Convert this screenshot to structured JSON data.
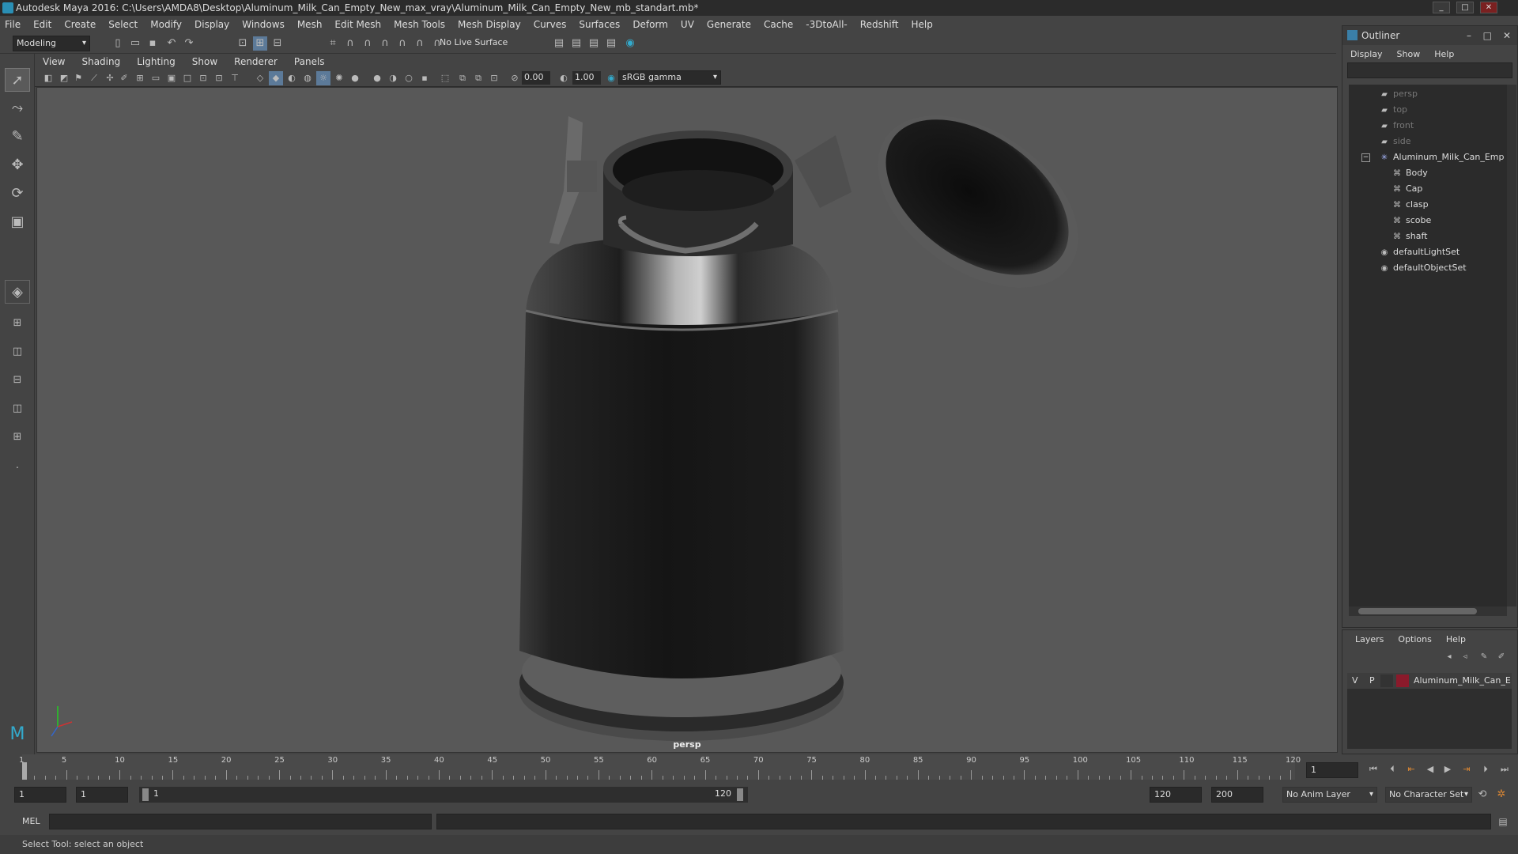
{
  "window": {
    "title": "Autodesk Maya 2016: C:\\Users\\AMDA8\\Desktop\\Aluminum_Milk_Can_Empty_New_max_vray\\Aluminum_Milk_Can_Empty_New_mb_standart.mb*"
  },
  "menubar": [
    "File",
    "Edit",
    "Create",
    "Select",
    "Modify",
    "Display",
    "Windows",
    "Mesh",
    "Edit Mesh",
    "Mesh Tools",
    "Mesh Display",
    "Curves",
    "Surfaces",
    "Deform",
    "UV",
    "Generate",
    "Cache",
    "-3DtoAll-",
    "Redshift",
    "Help"
  ],
  "statusline": {
    "mode": "Modeling",
    "live_surface": "No Live Surface"
  },
  "panel": {
    "menus": [
      "View",
      "Shading",
      "Lighting",
      "Show",
      "Renderer",
      "Panels"
    ],
    "exposure": "0.00",
    "gamma": "1.00",
    "color_space": "sRGB gamma",
    "camera_label": "persp"
  },
  "outliner": {
    "title": "Outliner",
    "menus": [
      "Display",
      "Show",
      "Help"
    ],
    "items": [
      {
        "label": "persp",
        "type": "camera"
      },
      {
        "label": "top",
        "type": "camera"
      },
      {
        "label": "front",
        "type": "camera"
      },
      {
        "label": "side",
        "type": "camera"
      },
      {
        "label": "Aluminum_Milk_Can_Emp",
        "type": "group"
      },
      {
        "label": "Body",
        "type": "mesh"
      },
      {
        "label": "Cap",
        "type": "mesh"
      },
      {
        "label": "clasp",
        "type": "mesh"
      },
      {
        "label": "scobe",
        "type": "mesh"
      },
      {
        "label": "shaft",
        "type": "mesh"
      },
      {
        "label": "defaultLightSet",
        "type": "set"
      },
      {
        "label": "defaultObjectSet",
        "type": "set"
      }
    ]
  },
  "layers": {
    "menus": [
      "Layers",
      "Options",
      "Help"
    ],
    "layer": {
      "v": "V",
      "p": "P",
      "name": "Aluminum_Milk_Can_E",
      "color": "#8b1a2b"
    }
  },
  "timeline": {
    "ticks": [
      "1",
      "5",
      "10",
      "15",
      "20",
      "25",
      "30",
      "35",
      "40",
      "45",
      "50",
      "55",
      "60",
      "65",
      "70",
      "75",
      "80",
      "85",
      "90",
      "95",
      "100",
      "105",
      "110",
      "115",
      "120"
    ],
    "current_frame": "1"
  },
  "range": {
    "start": "1",
    "playback_start": "1",
    "slider_start": "1",
    "slider_end": "120",
    "playback_end": "120",
    "end": "200",
    "anim_layer": "No Anim Layer",
    "character_set": "No Character Set"
  },
  "cmdline": {
    "label": "MEL"
  },
  "helpline": {
    "text": "Select Tool: select an object"
  },
  "colors": {
    "accent": "#2a8fb5",
    "viewport_bg": "#585858",
    "panel_bg": "#444444"
  }
}
